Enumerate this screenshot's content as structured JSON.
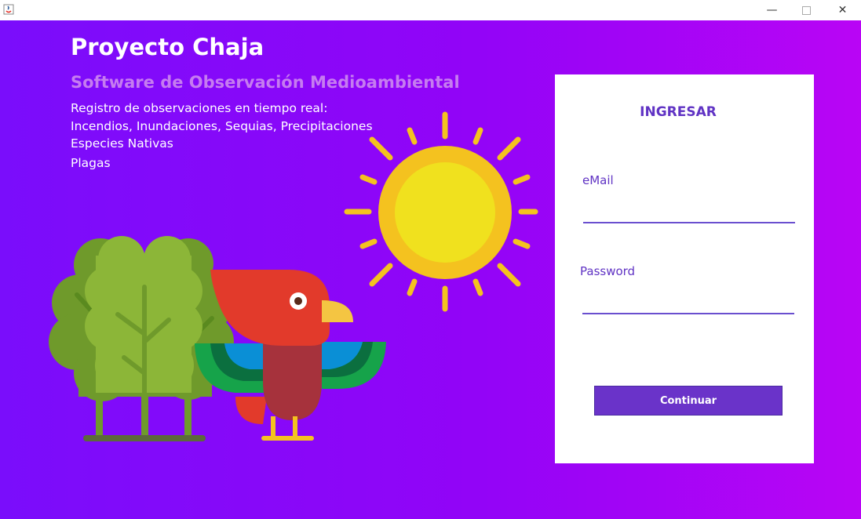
{
  "window": {
    "icon": "java-icon",
    "controls": [
      "minimize-icon",
      "maximize-icon",
      "close-icon"
    ]
  },
  "header": {
    "title": "Proyecto Chaja",
    "subtitle": "Software de Observación Medioambiental",
    "lines": [
      "Registro de observaciones en tiempo real:",
      "Incendios, Inundaciones, Sequias, Precipitaciones",
      "Especies Nativas",
      "Plagas"
    ]
  },
  "login": {
    "title": "INGRESAR",
    "email_label": "eMail",
    "email_value": "",
    "password_label": "Password",
    "password_value": "",
    "continue_label": "Continuar"
  },
  "colors": {
    "gradient_start": "#7a0dfb",
    "gradient_end": "#b905f5",
    "accent": "#6a33c9",
    "subtitle": "#c67cf0"
  }
}
